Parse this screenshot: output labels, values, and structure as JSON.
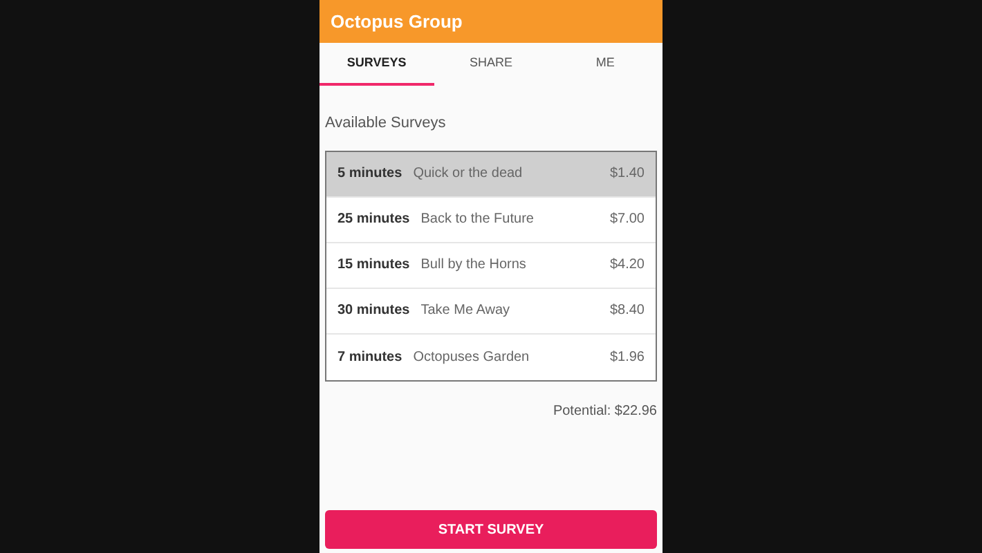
{
  "app_bar": {
    "title": "Octopus Group"
  },
  "tabs": [
    {
      "label": "SURVEYS",
      "selected": true
    },
    {
      "label": "SHARE",
      "selected": false
    },
    {
      "label": "ME",
      "selected": false
    }
  ],
  "section_title": "Available Surveys",
  "surveys": [
    {
      "duration": "5 minutes",
      "name": "Quick or the dead",
      "reward": "$1.40",
      "selected": true
    },
    {
      "duration": "25 minutes",
      "name": "Back to the Future",
      "reward": "$7.00",
      "selected": false
    },
    {
      "duration": "15 minutes",
      "name": "Bull by the Horns",
      "reward": "$4.20",
      "selected": false
    },
    {
      "duration": "30 minutes",
      "name": "Take Me Away",
      "reward": "$8.40",
      "selected": false
    },
    {
      "duration": "7 minutes",
      "name": "Octopuses Garden",
      "reward": "$1.96",
      "selected": false
    }
  ],
  "potential": "Potential: $22.96",
  "start_button": "START SURVEY"
}
